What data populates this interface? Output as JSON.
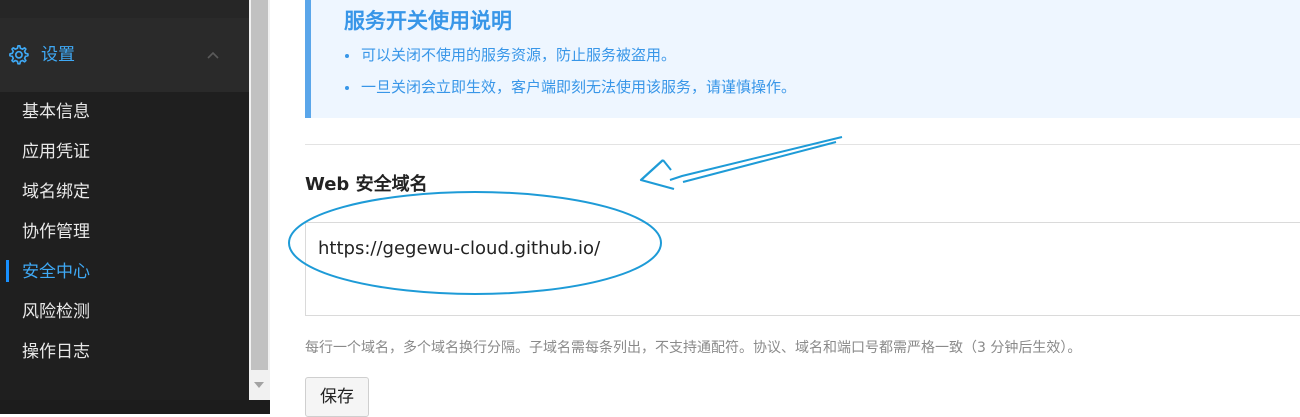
{
  "sidebar": {
    "settings_label": "设置",
    "items": [
      {
        "label": "基本信息",
        "active": false
      },
      {
        "label": "应用凭证",
        "active": false
      },
      {
        "label": "域名绑定",
        "active": false
      },
      {
        "label": "协作管理",
        "active": false
      },
      {
        "label": "安全中心",
        "active": true
      },
      {
        "label": "风险检测",
        "active": false
      },
      {
        "label": "操作日志",
        "active": false
      }
    ]
  },
  "main": {
    "info": {
      "title": "服务开关使用说明",
      "lines": [
        "可以关闭不使用的服务资源，防止服务被盗用。",
        "一旦关闭会立即生效，客户端即刻无法使用该服务，请谨慎操作。"
      ]
    },
    "web_domain": {
      "title": "Web 安全域名",
      "value": "https://gegewu-cloud.github.io/",
      "hint": "每行一个域名，多个域名换行分隔。子域名需每条列出，不支持通配符。协议、域名和端口号都需严格一致（3 分钟后生效）。",
      "save_label": "保存"
    }
  },
  "colors": {
    "accent": "#3fa9f5",
    "info_text": "#3896e8",
    "annotation": "#1e9bd7"
  }
}
